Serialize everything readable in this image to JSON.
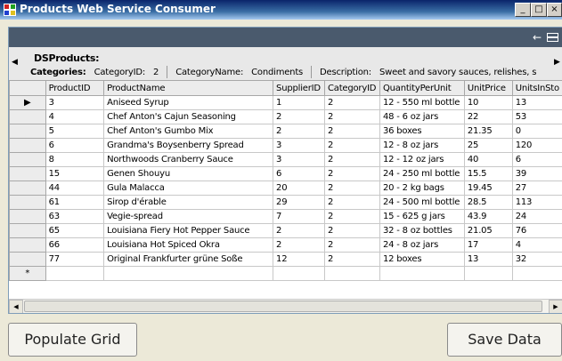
{
  "window": {
    "title": "Products Web Service Consumer"
  },
  "grid": {
    "dataset_name": "DSProducts:",
    "parent": {
      "table_label": "Categories:",
      "fields": [
        {
          "label": "CategoryID:",
          "value": "2"
        },
        {
          "label": "CategoryName:",
          "value": "Condiments"
        },
        {
          "label": "Description:",
          "value": "Sweet and savory sauces, relishes, s"
        }
      ]
    },
    "columns": [
      "ProductID",
      "ProductName",
      "SupplierID",
      "CategoryID",
      "QuantityPerUnit",
      "UnitPrice",
      "UnitsInSto"
    ],
    "rows": [
      [
        "3",
        "Aniseed Syrup",
        "1",
        "2",
        "12 - 550 ml bottle",
        "10",
        "13"
      ],
      [
        "4",
        "Chef Anton's Cajun Seasoning",
        "2",
        "2",
        "48 - 6 oz jars",
        "22",
        "53"
      ],
      [
        "5",
        "Chef Anton's Gumbo Mix",
        "2",
        "2",
        "36 boxes",
        "21.35",
        "0"
      ],
      [
        "6",
        "Grandma's Boysenberry Spread",
        "3",
        "2",
        "12 - 8 oz jars",
        "25",
        "120"
      ],
      [
        "8",
        "Northwoods Cranberry Sauce",
        "3",
        "2",
        "12 - 12 oz jars",
        "40",
        "6"
      ],
      [
        "15",
        "Genen Shouyu",
        "6",
        "2",
        "24 - 250 ml bottle",
        "15.5",
        "39"
      ],
      [
        "44",
        "Gula Malacca",
        "20",
        "2",
        "20 - 2 kg bags",
        "19.45",
        "27"
      ],
      [
        "61",
        "Sirop d'érable",
        "29",
        "2",
        "24 - 500 ml bottle",
        "28.5",
        "113"
      ],
      [
        "63",
        "Vegie-spread",
        "7",
        "2",
        "15 - 625 g jars",
        "43.9",
        "24"
      ],
      [
        "65",
        "Louisiana Fiery Hot Pepper Sauce",
        "2",
        "2",
        "32 - 8 oz bottles",
        "21.05",
        "76"
      ],
      [
        "66",
        "Louisiana Hot Spiced Okra",
        "2",
        "2",
        "24 - 8 oz jars",
        "17",
        "4"
      ],
      [
        "77",
        "Original Frankfurter grüne Soße",
        "12",
        "2",
        "12 boxes",
        "13",
        "32"
      ]
    ],
    "new_row_marker": "*",
    "current_row_marker": "▶"
  },
  "buttons": {
    "populate": "Populate Grid",
    "save": "Save Data"
  },
  "icons": [
    "app-icon",
    "minimize-icon",
    "maximize-icon",
    "close-icon",
    "back-arrow-icon",
    "collapse-icon",
    "scroll-left-icon",
    "scroll-right-icon"
  ]
}
